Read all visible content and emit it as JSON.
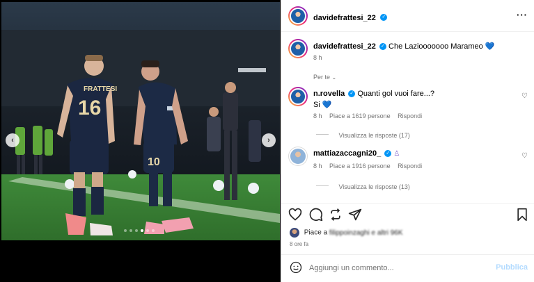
{
  "post": {
    "author": "davidefrattesi_22",
    "caption_author": "davidefrattesi_22",
    "caption": "Che Laziooooooo Marameo 💙",
    "caption_time": "8 h",
    "sort_label": "Per te",
    "jersey_left": "16",
    "jersey_left_name": "FRATTESI",
    "jersey_right": "10"
  },
  "comments": [
    {
      "user": "n.rovella",
      "text": "Quanti gol vuoi fare...?",
      "reply_line": "Si 💙",
      "time": "8 h",
      "likes": "Piace a 1619 persone",
      "reply_label": "Rispondi",
      "view_replies": "Visualizza le risposte (17)"
    },
    {
      "user": "mattiazaccagni20_",
      "text": "",
      "time": "8 h",
      "likes": "Piace a 1916 persone",
      "reply_label": "Rispondi",
      "view_replies": "Visualizza le risposte (13)"
    }
  ],
  "footer": {
    "likes_prefix": "Piace a",
    "likes_rest": "filippoinzaghi e altri 96K",
    "time_ago": "8 ore fa",
    "comment_placeholder": "Aggiungi un commento...",
    "publish_label": "Pubblica"
  },
  "carousel": {
    "total": 6,
    "active": 3
  },
  "colors": {
    "accent": "#0095f6",
    "publish_disabled": "#b3dbff",
    "text_secondary": "#737373"
  }
}
